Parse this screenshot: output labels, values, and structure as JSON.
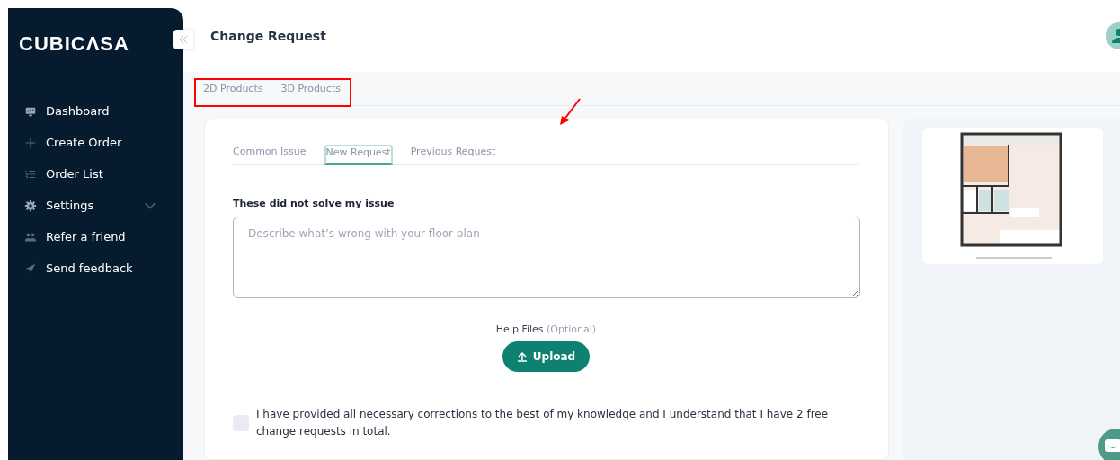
{
  "sidebar": {
    "logo": "CUBICΛSA",
    "items": [
      {
        "label": "Dashboard",
        "kind": "monitor",
        "expandable": false
      },
      {
        "label": "Create Order",
        "kind": "plus",
        "expandable": false
      },
      {
        "label": "Order List",
        "kind": "list",
        "expandable": false
      },
      {
        "label": "Settings",
        "kind": "gear",
        "expandable": true
      },
      {
        "label": "Refer a friend",
        "kind": "people",
        "expandable": false
      },
      {
        "label": "Send feedback",
        "kind": "send",
        "expandable": false
      }
    ]
  },
  "header": {
    "title": "Change Request"
  },
  "product_tabs": [
    {
      "label": "2D Products",
      "selected": false
    },
    {
      "label": "3D Products",
      "selected": false
    }
  ],
  "request_tabs": [
    {
      "label": "Common Issue",
      "selected": false
    },
    {
      "label": "New Request",
      "selected": true
    },
    {
      "label": "Previous Request",
      "selected": false
    }
  ],
  "form": {
    "label": "These did not solve my issue",
    "placeholder": "Describe what’s wrong with your floor plan",
    "help_label": "Help Files",
    "help_optional": "(Optional)",
    "upload": "Upload",
    "agreement": {
      "text": "I have provided all necessary corrections to the best of my knowledge and I understand that I have 2 free change requests in total.",
      "checked": false
    }
  }
}
